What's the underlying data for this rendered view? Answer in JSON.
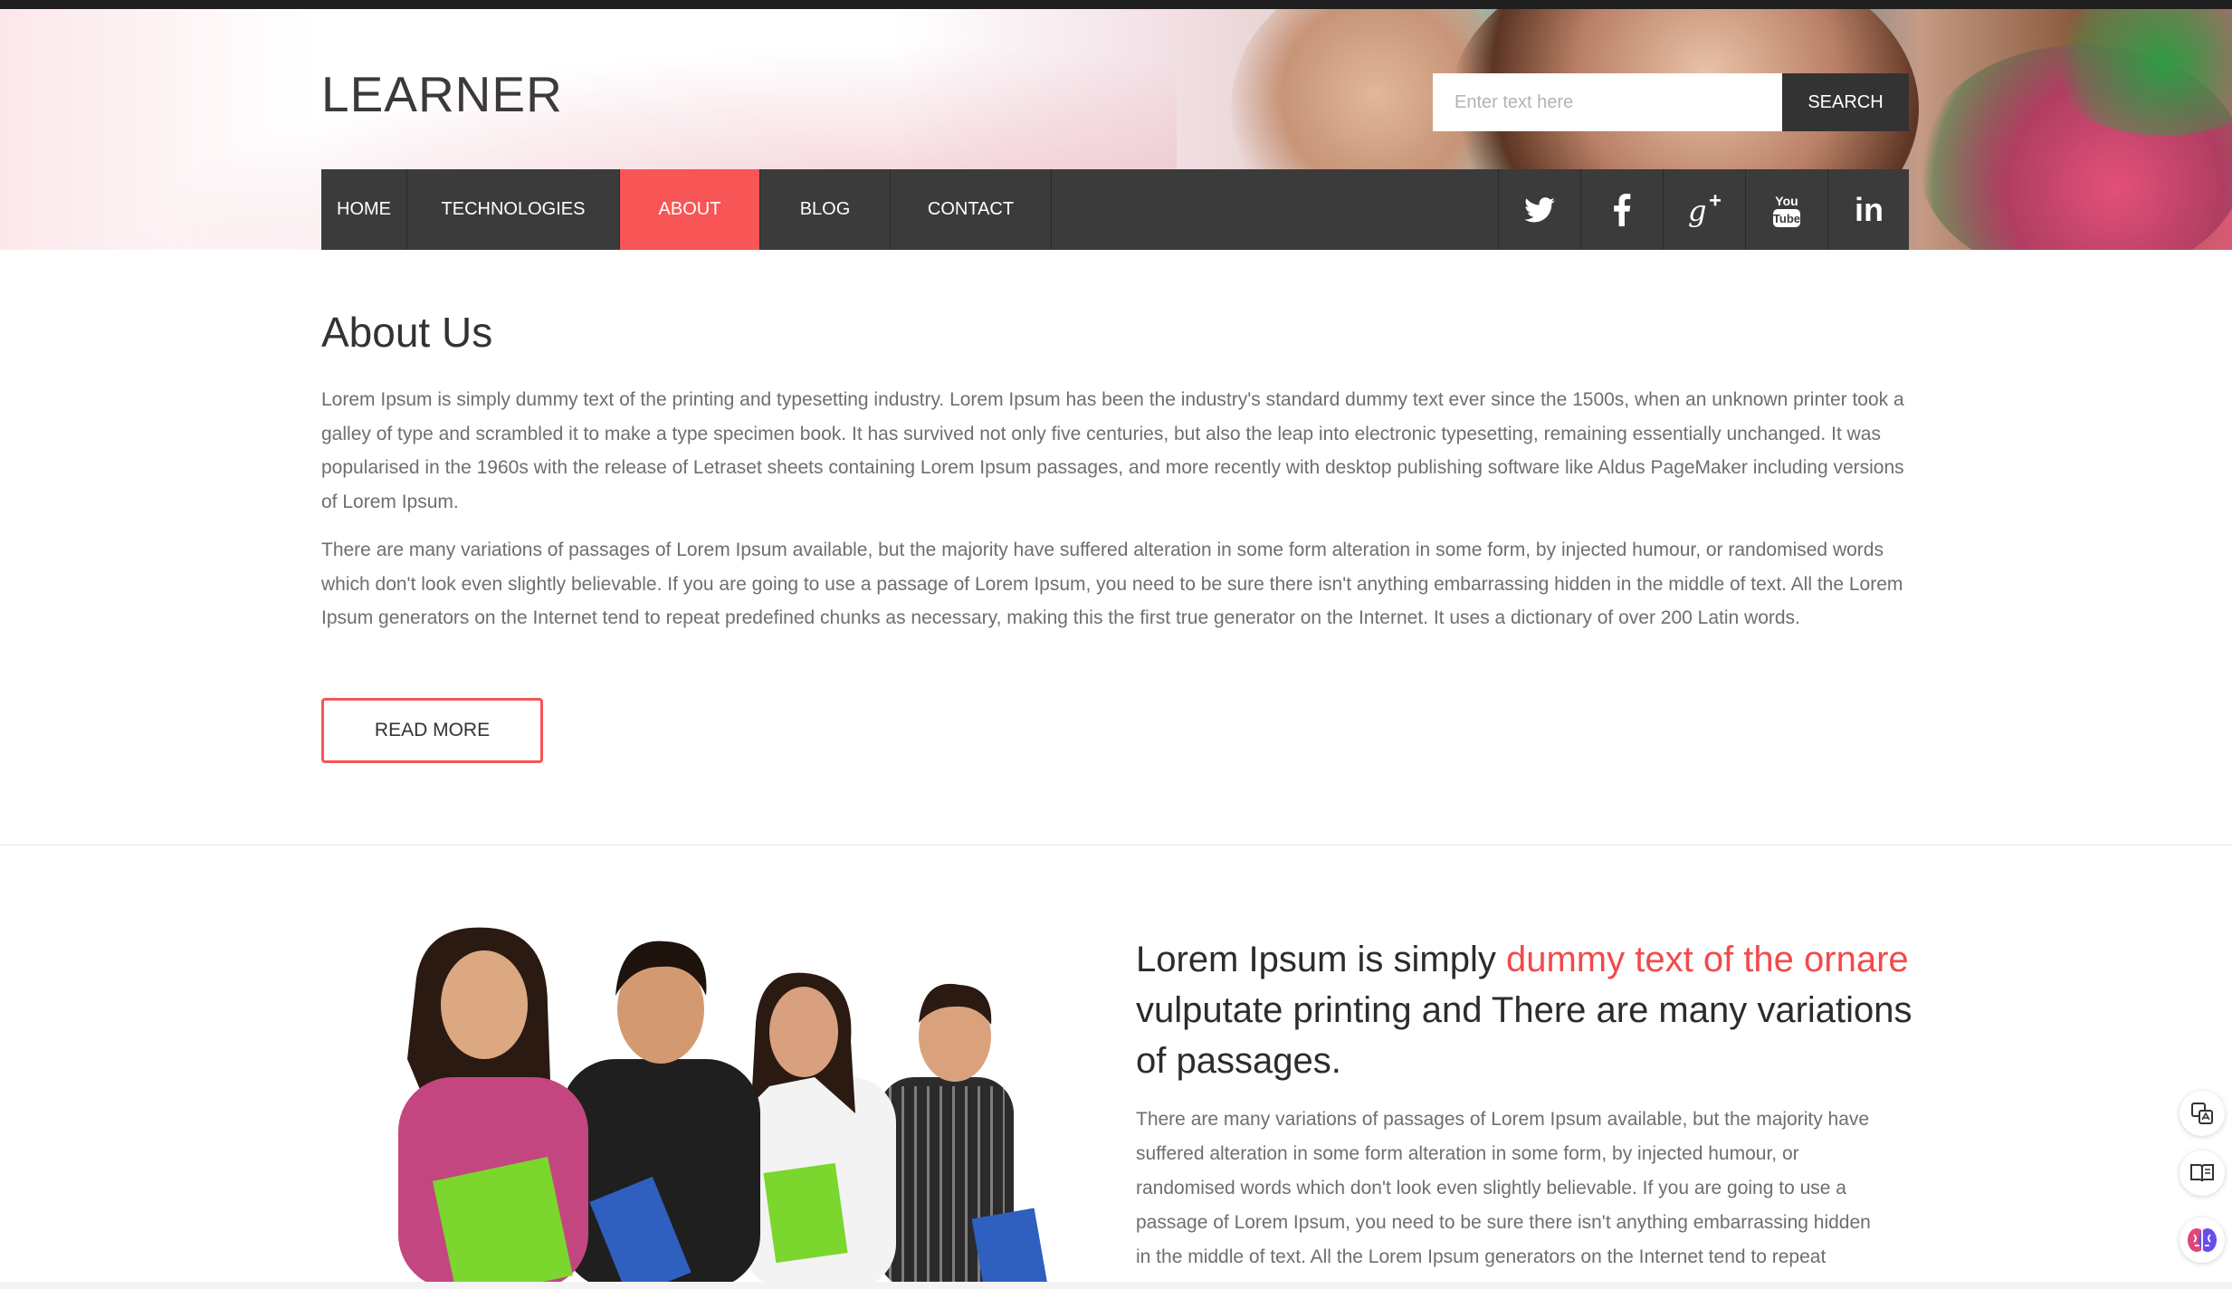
{
  "site": {
    "logo": "LEARNER"
  },
  "search": {
    "placeholder": "Enter text here",
    "button_label": "SEARCH"
  },
  "nav": {
    "items": [
      {
        "label": "HOME"
      },
      {
        "label": "TECHNOLOGIES"
      },
      {
        "label": "ABOUT",
        "active": true
      },
      {
        "label": "BLOG"
      },
      {
        "label": "CONTACT"
      }
    ],
    "social": [
      "twitter-icon",
      "facebook-icon",
      "google-plus-icon",
      "youtube-icon",
      "linkedin-icon"
    ],
    "youtube_text": {
      "top": "You",
      "bottom": "Tube"
    },
    "linkedin_text": "in"
  },
  "about": {
    "title": "About Us",
    "paragraph1": "Lorem Ipsum is simply dummy text of the printing and typesetting industry. Lorem Ipsum has been the industry's standard dummy text ever since the 1500s, when an unknown printer took a galley of type and scrambled it to make a type specimen book. It has survived not only five centuries, but also the leap into electronic typesetting, remaining essentially unchanged. It was popularised in the 1960s with the release of Letraset sheets containing Lorem Ipsum passages, and more recently with desktop publishing software like Aldus PageMaker including versions of Lorem Ipsum.",
    "paragraph2": "There are many variations of passages of Lorem Ipsum available, but the majority have suffered alteration in some form alteration in some form, by injected humour, or randomised words which don't look even slightly believable. If you are going to use a passage of Lorem Ipsum, you need to be sure there isn't anything embarrassing hidden in the middle of text. All the Lorem Ipsum generators on the Internet tend to repeat predefined chunks as necessary, making this the first true generator on the Internet. It uses a dictionary of over 200 Latin words.",
    "read_more": "READ MORE"
  },
  "feature": {
    "heading_part1": "Lorem Ipsum is simply ",
    "heading_highlight": "dummy text of the ornare",
    "heading_part2": " vulputate printing and There are many variations of passages.",
    "paragraph": "There are many variations of passages of Lorem Ipsum available, but the majority have suffered alteration in some form alteration in some form, by injected humour, or randomised words which don't look even slightly believable. If you are going to use a passage of Lorem Ipsum, you need to be sure there isn't anything embarrassing hidden in the middle of text. All the Lorem Ipsum generators on the Internet tend to repeat predefined chunks as necessary."
  },
  "side_widgets": [
    "translate-icon",
    "reader-icon",
    "ai-brain-icon"
  ],
  "colors": {
    "accent": "#f75556",
    "nav_bg": "#3b3b3b",
    "text": "#6e6e6e",
    "heading": "#333333"
  }
}
